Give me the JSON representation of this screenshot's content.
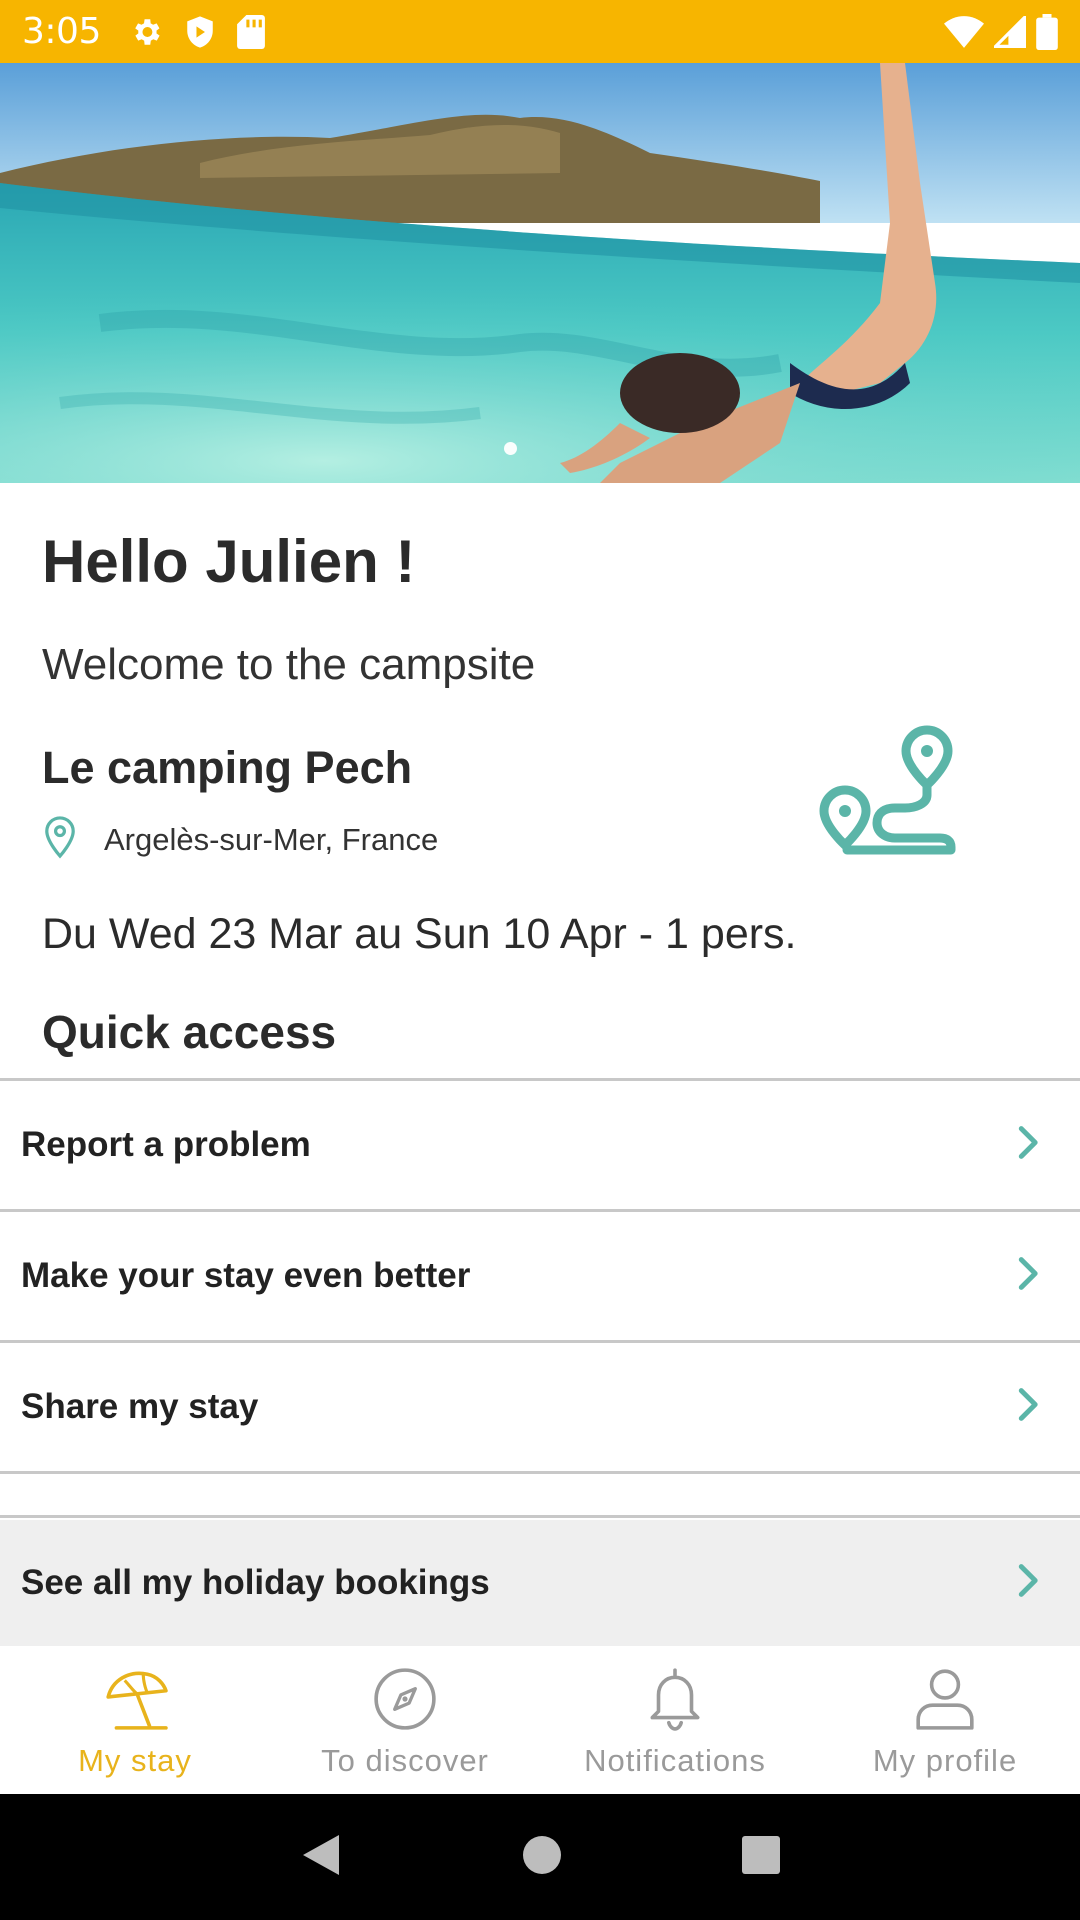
{
  "status_bar": {
    "time": "3:05",
    "icons": [
      "gear-icon",
      "shield-icon",
      "sd-card-icon",
      "wifi-icon",
      "signal-icon",
      "battery-icon"
    ],
    "background": "#F7B500"
  },
  "hero": {
    "image": "underwater-swimmer-photo",
    "carousel_dots": 1
  },
  "greeting": "Hello Julien !",
  "welcome": "Welcome to the campsite",
  "campsite": {
    "name": "Le camping Pech",
    "location": "Argelès-sur-Mer, France",
    "icon": "route-map-icon"
  },
  "stay_dates": "Du Wed 23 Mar au Sun 10 Apr - 1 pers.",
  "quick_access": {
    "title": "Quick access",
    "items": [
      {
        "label": "Report a problem"
      },
      {
        "label": "Make your stay even better"
      },
      {
        "label": "Share my stay"
      }
    ]
  },
  "bookings": {
    "label": "See all my holiday bookings"
  },
  "bottom_nav": {
    "items": [
      {
        "label": "My stay",
        "icon": "beach-umbrella-icon",
        "active": true
      },
      {
        "label": "To discover",
        "icon": "compass-icon",
        "active": false
      },
      {
        "label": "Notifications",
        "icon": "bell-icon",
        "active": false
      },
      {
        "label": "My profile",
        "icon": "person-icon",
        "active": false
      }
    ]
  },
  "colors": {
    "accent_yellow": "#F7B500",
    "active_tab": "#E8B31C",
    "teal": "#5BB5A8"
  }
}
